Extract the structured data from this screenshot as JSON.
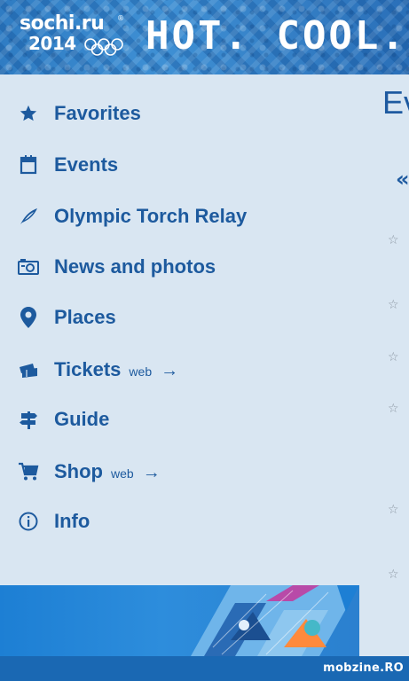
{
  "header": {
    "logo_top": "sochi.ru",
    "logo_bottom": "2014",
    "registered": "®",
    "slogan": "HOT. COOL. YO"
  },
  "menu": {
    "items": [
      {
        "label": "Favorites",
        "icon": "star-icon"
      },
      {
        "label": "Events",
        "icon": "calendar-icon"
      },
      {
        "label": "Olympic Torch Relay",
        "icon": "torch-flame-icon"
      },
      {
        "label": "News and photos",
        "icon": "camera-news-icon"
      },
      {
        "label": "Places",
        "icon": "map-pin-icon"
      },
      {
        "label": "Tickets",
        "icon": "tickets-icon",
        "tag": "web",
        "arrow": "→"
      },
      {
        "label": "Guide",
        "icon": "signpost-icon"
      },
      {
        "label": "Shop",
        "icon": "cart-icon",
        "tag": "web",
        "arrow": "→"
      },
      {
        "label": "Info",
        "icon": "info-icon"
      }
    ]
  },
  "peek": {
    "title": "Ev",
    "chevron": "«",
    "star": "☆"
  },
  "watermark": "mobzine.RO",
  "colors": {
    "accent": "#1d5a9e",
    "background": "#d9e6f2",
    "header": "#2f7cc3"
  }
}
